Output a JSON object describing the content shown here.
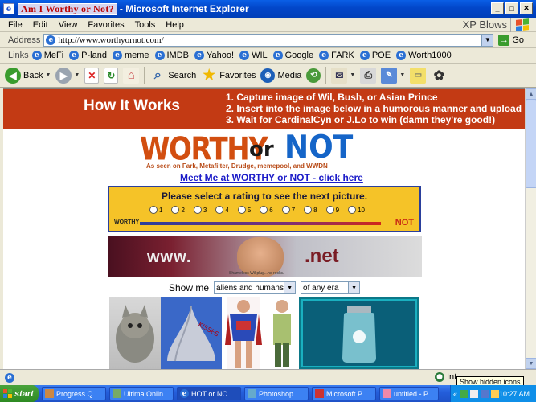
{
  "window": {
    "title_boxed": "Am I Worthy or Not?",
    "title_rest": "- Microsoft Internet Explorer"
  },
  "menu": {
    "items": [
      "File",
      "Edit",
      "View",
      "Favorites",
      "Tools",
      "Help"
    ],
    "xp_text": "XP Blows"
  },
  "address": {
    "label": "Address",
    "url": "http://www.worthyornot.com/",
    "go_label": "Go"
  },
  "links": {
    "label": "Links",
    "items": [
      "MeFi",
      "P-land",
      "meme",
      "IMDB",
      "Yahoo!",
      "WIL",
      "Google",
      "FARK",
      "POE",
      "Worth1000"
    ]
  },
  "toolbar": {
    "back_label": "Back",
    "search_label": "Search",
    "favorites_label": "Favorites",
    "media_label": "Media"
  },
  "page": {
    "banner_title": "How It Works",
    "steps": [
      "1. Capture image of Wil, Bush, or Asian Prince",
      "2. Insert into the image below in a humorous manner and upload",
      "3. Wait for CardinalCyn or J.Lo to win (damn they're good!)"
    ],
    "logo_worthy": "WORTHY",
    "logo_or": "or",
    "logo_not": "NOT",
    "logo_seen": "As seen on Fark, Metafilter, Drudge, memepool, and WWDN",
    "meetme": "Meet Me at WORTHY or NOT - click here",
    "rating_prompt": "Please select a rating to see the next picture.",
    "rating_options": [
      "1",
      "2",
      "3",
      "4",
      "5",
      "6",
      "7",
      "8",
      "9",
      "10"
    ],
    "rating_low": "WORTHY",
    "rating_high": "NOT",
    "ad_www": "www.",
    "ad_net": ".net",
    "ad_caption": "Shameless Wil plug...he rocks.",
    "show_me_label": "Show me",
    "filter_1": "aliens and humans",
    "filter_2": "of any era",
    "thumb_kisses_text": "KISSES"
  },
  "status": {
    "zone_text": "Int",
    "tooltip": "Show hidden icons"
  },
  "taskbar": {
    "start_label": "start",
    "tasks": [
      "Progress Q...",
      "Ultima Onlin...",
      "HOT or NO...",
      "Photoshop ...",
      "Microsoft P...",
      "untitled - P..."
    ],
    "active_index": 2,
    "clock": "10:27 AM"
  }
}
